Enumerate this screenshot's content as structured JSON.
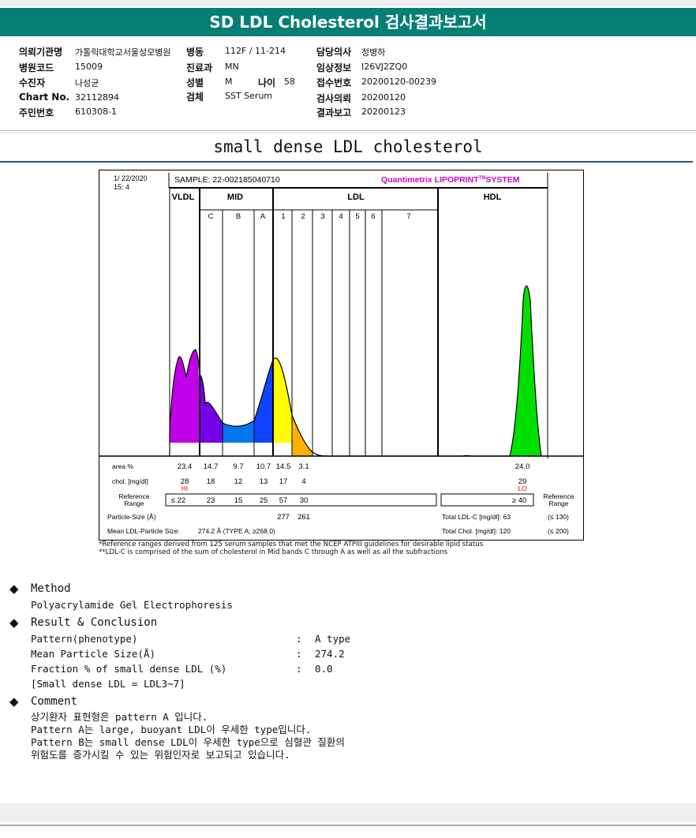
{
  "header": {
    "title": "SD LDL Cholesterol 검사결과보고서"
  },
  "info": [
    {
      "label": "의뢰기관명",
      "value": "가톨릭대학교서울성모병원"
    },
    {
      "label": "병원코드",
      "value": "15009"
    },
    {
      "label": "수진자",
      "value": "나성균"
    },
    {
      "label": "Chart No.",
      "value": "32112894"
    },
    {
      "label": "주민번호",
      "value": "610308-1"
    },
    {
      "label": "병동",
      "value": "112F / 11-214"
    },
    {
      "label": "진료과",
      "value": "MN"
    },
    {
      "label": "성별",
      "value": "M"
    },
    {
      "label": "나이",
      "value": "58"
    },
    {
      "label": "검체",
      "value": "SST Serum"
    },
    {
      "label": "담당의사",
      "value": "정병하"
    },
    {
      "label": "임상정보",
      "value": "I26VJ2ZQ0"
    },
    {
      "label": "접수번호",
      "value": "20200120-00239"
    },
    {
      "label": "검사의뢰",
      "value": "20200120"
    },
    {
      "label": "결과보고",
      "value": "20200123"
    }
  ],
  "section_title": "small dense LDL cholesterol",
  "chart_data": {
    "type": "area",
    "date": "1/ 22/2020",
    "time": "15: 4",
    "sample": "SAMPLE:   22-002185040710",
    "system": "Quantimetrix LIPOPRINT",
    "system_tm": "TM",
    "system_suffix": "SYSTEM",
    "groups": [
      "VLDL",
      "MID",
      "LDL",
      "HDL"
    ],
    "bands": [
      "C",
      "B",
      "A",
      "1",
      "2",
      "3",
      "4",
      "5",
      "6",
      "7"
    ],
    "colors": {
      "vldl": "#c000e8",
      "mid_c": "#7700e8",
      "mid_b": "#0077ee",
      "mid_a": "#1144ff",
      "ldl1": "#ffff00",
      "ldl2": "#ffb000",
      "hdl": "#00e000",
      "title": "#cc00cc"
    },
    "row_labels": {
      "area": "area %",
      "chol": "chol. [mg/dl]",
      "ref": "Reference Range",
      "size": "Particle-Size (Å)",
      "mean": "Mean LDL-Particle Size:"
    },
    "area_values": [
      "23.4",
      "14.7",
      "9.7",
      "10.7",
      "14.5",
      "3.1"
    ],
    "hdl_area": "24.0",
    "chol_values": [
      "28",
      "18",
      "12",
      "13",
      "17",
      "4"
    ],
    "hdl_chol": "29",
    "flag_hi": "HI",
    "flag_lo": "LO",
    "ref_values": [
      "≤ 22",
      "23",
      "15",
      "25",
      "57",
      "30"
    ],
    "hdl_ref": "≥ 40",
    "ref_right": "Reference Range",
    "size_values": [
      "277",
      "261"
    ],
    "mean_size": "274.2 Å  (TYPE A; ≥268.0)",
    "total_ldl": "Total LDL-C [mg/dl]: 63",
    "total_ldl_ref": "(≤ 130)",
    "total_chol": "Total Chol. [mg/dl]:  120",
    "total_chol_ref": "(≤ 200)"
  },
  "footnotes": [
    "*Reference ranges derived from 125 serum samples that met the NCEP ATPIII guidelines for desirable lipid status",
    "**LDL-C is comprised of the sum of cholesterol in Mid bands C through A as well as all the subfractions"
  ],
  "method": {
    "heading": "Method",
    "text": "Polyacrylamide Gel Electrophoresis"
  },
  "result": {
    "heading": "Result & Conclusion",
    "rows": [
      {
        "label": "Pattern(phenotype)",
        "colon": ":",
        "value": "A type"
      },
      {
        "label": "Mean Particle Size(Å)",
        "colon": ":",
        "value": "274.2"
      },
      {
        "label": "Fraction % of small dense LDL (%)",
        "colon": ":",
        "value": "0.0"
      }
    ],
    "note": "[Small dense LDL = LDL3~7]"
  },
  "comment": {
    "heading": "Comment",
    "lines": [
      "상기환자 표현형은 pattern A 입니다.",
      "Pattern A는 large, buoyant LDL이 우세한 type입니다.",
      "Pattern B는 small dense LDL이 우세한 type으로 심혈관 질환의",
      "위험도를 증가시킬 수 있는 위험인자로 보고되고 있습니다."
    ]
  }
}
